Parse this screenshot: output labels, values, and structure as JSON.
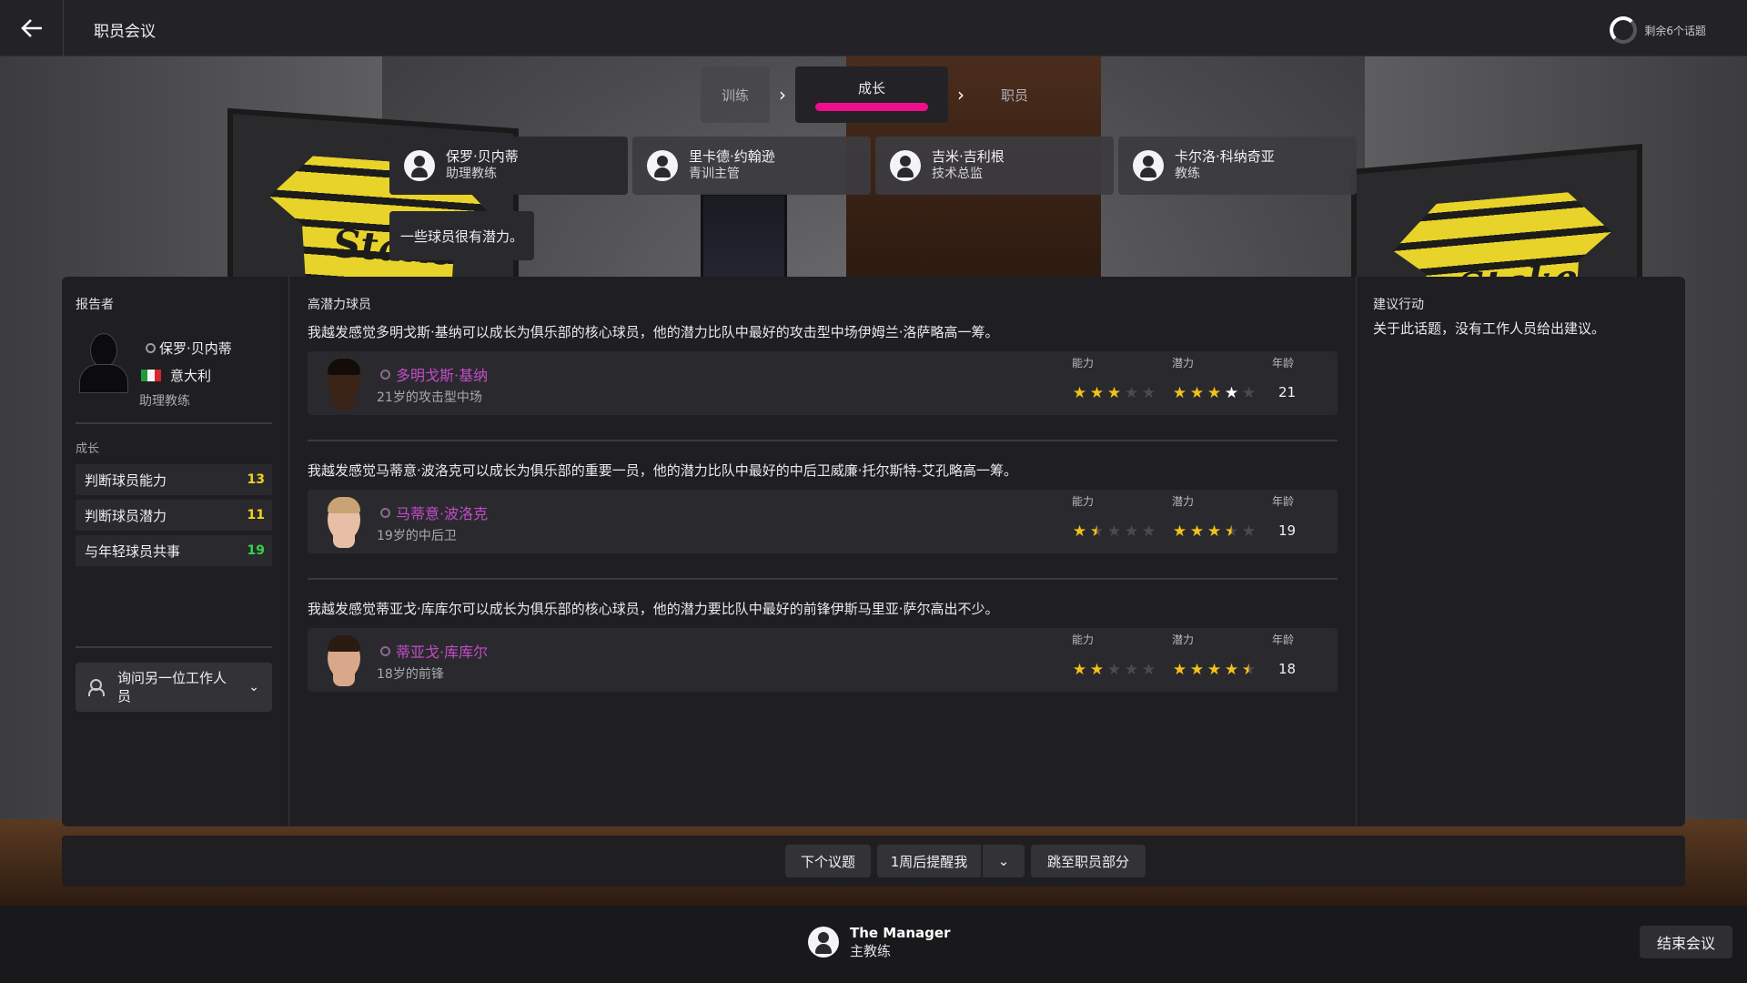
{
  "header": {
    "title": "职员会议",
    "topics_left": "剩余6个话题"
  },
  "stepper": {
    "steps": [
      "训练",
      "成长",
      "职员"
    ],
    "active_index": 1
  },
  "staff": [
    {
      "name": "保罗·贝内蒂",
      "role": "助理教练"
    },
    {
      "name": "里卡德·约翰逊",
      "role": "青训主管"
    },
    {
      "name": "吉米·吉利根",
      "role": "技术总监"
    },
    {
      "name": "卡尔洛·科纳奇亚",
      "role": "教练"
    }
  ],
  "speech": "一些球员很有潜力。",
  "reporter": {
    "section_title": "报告者",
    "name": "保罗·贝内蒂",
    "nation": "意大利",
    "role": "助理教练"
  },
  "growth": {
    "title": "成长",
    "attributes": [
      {
        "label": "判断球员能力",
        "value": "13",
        "color": "#f2d21a"
      },
      {
        "label": "判断球员潜力",
        "value": "11",
        "color": "#f2d21a"
      },
      {
        "label": "与年轻球员共事",
        "value": "19",
        "color": "#35d24a"
      }
    ]
  },
  "ask_button": "询问另一位工作人员",
  "high_potential": {
    "title": "高潜力球员",
    "headers": {
      "ability": "能力",
      "potential": "潜力",
      "age": "年龄"
    },
    "players": [
      {
        "desc": "我越发感觉多明戈斯·基纳可以成长为俱乐部的核心球员，他的潜力比队中最好的攻击型中场伊姆兰·洛萨略高一筹。",
        "name": "多明戈斯·基纳",
        "sub": "21岁的攻击型中场",
        "ability_stars": 3,
        "potential_stars": 4,
        "age": "21",
        "skin": "#3a2418",
        "hair": "#140c08"
      },
      {
        "desc": "我越发感觉马蒂意·波洛克可以成长为俱乐部的重要一员，他的潜力比队中最好的中后卫威廉·托尔斯特-艾孔略高一筹。",
        "name": "马蒂意·波洛克",
        "sub": "19岁的中后卫",
        "ability_stars": 1.5,
        "potential_stars": 3.5,
        "age": "19",
        "skin": "#e8bfa6",
        "hair": "#c8a474"
      },
      {
        "desc": "我越发感觉蒂亚戈·库库尔可以成长为俱乐部的核心球员，他的潜力要比队中最好的前锋伊斯马里亚·萨尔高出不少。",
        "name": "蒂亚戈·库库尔",
        "sub": "18岁的前锋",
        "ability_stars": 2,
        "potential_stars": 4.5,
        "age": "18",
        "skin": "#d9a88a",
        "hair": "#2a1a12"
      }
    ]
  },
  "suggested": {
    "title": "建议行动",
    "text": "关于此话题，没有工作人员给出建议。"
  },
  "actions": {
    "next_topic": "下个议题",
    "remind": "1周后提醒我",
    "jump": "跳至职员部分"
  },
  "manager": {
    "name": "The Manager",
    "role": "主教练"
  },
  "end_meeting": "结束会议",
  "colors": {
    "accent": "#ef0e8a",
    "star": "#f2c21a",
    "player_name": "#c24bc8"
  }
}
